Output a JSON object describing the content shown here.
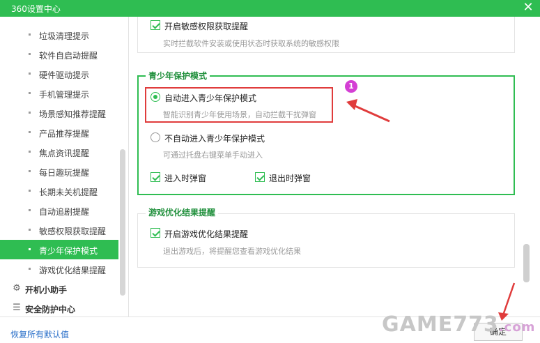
{
  "window": {
    "title": "360设置中心",
    "close_glyph": "✕"
  },
  "sidebar": {
    "items": [
      {
        "label": "垃圾清理提示",
        "active": false
      },
      {
        "label": "软件自启动提醒",
        "active": false
      },
      {
        "label": "硬件驱动提示",
        "active": false
      },
      {
        "label": "手机管理提示",
        "active": false
      },
      {
        "label": "场景感知推荐提醒",
        "active": false
      },
      {
        "label": "产品推荐提醒",
        "active": false
      },
      {
        "label": "焦点资讯提醒",
        "active": false
      },
      {
        "label": "每日趣玩提醒",
        "active": false
      },
      {
        "label": "长期未关机提醒",
        "active": false
      },
      {
        "label": "自动追剧提醒",
        "active": false
      },
      {
        "label": "敏感权限获取提醒",
        "active": false
      },
      {
        "label": "青少年保护模式",
        "active": true
      },
      {
        "label": "游戏优化结果提醒",
        "active": false
      }
    ],
    "groups": [
      {
        "label": "开机小助手",
        "icon": "gear-icon"
      },
      {
        "label": "安全防护中心",
        "icon": "list-icon"
      }
    ]
  },
  "sensitive_section": {
    "checkbox_label": "开启敏感权限获取提醒",
    "description": "实时拦截软件安装或使用状态时获取系统的敏感权限"
  },
  "youth_section": {
    "legend": "青少年保护模式",
    "auto_label": "自动进入青少年保护模式",
    "auto_desc": "智能识别青少年使用场景，自动拦截干扰弹窗",
    "manual_label": "不自动进入青少年保护模式",
    "manual_desc": "可通过托盘右键菜单手动进入",
    "enter_popup_label": "进入时弹窗",
    "exit_popup_label": "退出时弹窗"
  },
  "game_section": {
    "legend": "游戏优化结果提醒",
    "checkbox_label": "开启游戏优化结果提醒",
    "description": "退出游戏后，将提醒您查看游戏优化结果"
  },
  "footer": {
    "restore_label": "恢复所有默认值",
    "ok_label": "确定"
  },
  "annotation": {
    "marker": "1",
    "highlight_color": "#e03c3c",
    "marker_color": "#d43fd4"
  },
  "watermark": {
    "text": "GAME773",
    "suffix": ".com"
  },
  "colors": {
    "accent": "#2fbd52",
    "legend_text": "#1f8f3b",
    "link": "#2a6fc9"
  }
}
